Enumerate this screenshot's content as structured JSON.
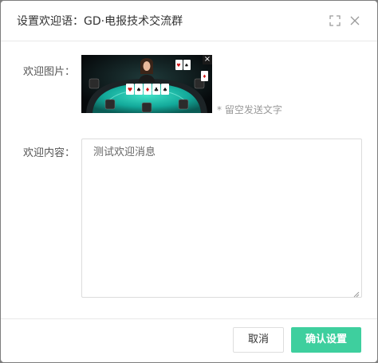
{
  "dialog": {
    "title": "设置欢迎语：GD·电报技术交流群",
    "maximize_icon": "maximize-icon",
    "close_icon": "close-icon"
  },
  "form": {
    "image_label": "欢迎图片：",
    "image_close_glyph": "×",
    "image_hint": "* 留空发送文字",
    "content_label": "欢迎内容：",
    "content_value": "测试欢迎消息"
  },
  "footer": {
    "cancel_label": "取消",
    "confirm_label": "确认设置"
  },
  "colors": {
    "accent": "#3ecf9e",
    "overlay": "#7d7d7d",
    "table_felt": "#13a99a"
  }
}
